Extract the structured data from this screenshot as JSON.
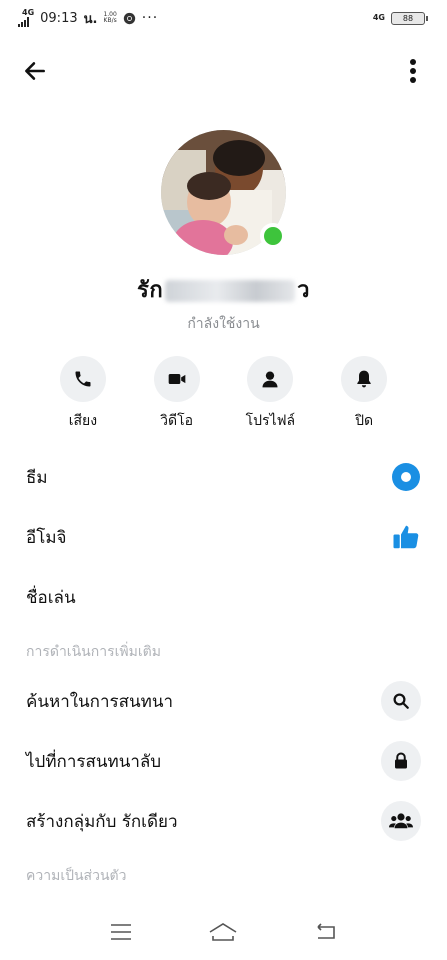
{
  "status_bar": {
    "network_left": "4G",
    "time": "09:13",
    "carrier": "น.",
    "speed_value": "1.00",
    "speed_unit": "KB/s",
    "more": "···",
    "network_right": "4G",
    "battery": "88"
  },
  "profile": {
    "name_prefix": "รัก",
    "name_suffix": "ว",
    "status": "กำลังใช้งาน",
    "online_color": "#3ec43c"
  },
  "actions": [
    {
      "label": "เสียง",
      "icon": "phone-icon"
    },
    {
      "label": "วิดีโอ",
      "icon": "video-camera-icon"
    },
    {
      "label": "โปรไฟล์",
      "icon": "person-icon"
    },
    {
      "label": "ปิด",
      "icon": "bell-icon"
    }
  ],
  "settings": {
    "theme_label": "ธีม",
    "emoji_label": "อีโมจิ",
    "nickname_label": "ชื่อเล่น",
    "more_actions_title": "การดำเนินการเพิ่มเติม",
    "search_label": "ค้นหาในการสนทนา",
    "secret_label": "ไปที่การสนทนาลับ",
    "group_label": "สร้างกลุ่มกับ รักเดียว",
    "privacy_title": "ความเป็นส่วนตัว"
  },
  "colors": {
    "accent": "#1a8fe3",
    "chip_bg": "#eef0f2",
    "muted_text": "#b0b3b8"
  }
}
